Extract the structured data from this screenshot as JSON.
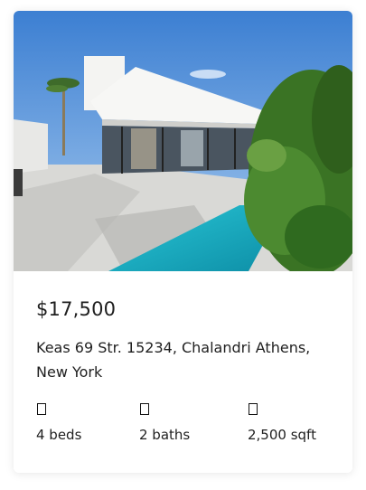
{
  "listing": {
    "price": "$17,500",
    "address": "Keas 69 Str. 15234, Chalandri Athens, New York",
    "features": [
      {
        "icon": "bed-icon",
        "label": "4 beds"
      },
      {
        "icon": "bath-icon",
        "label": "2 baths"
      },
      {
        "icon": "area-icon",
        "label": "2,500 sqft"
      }
    ]
  },
  "colors": {
    "sky": "#4f8fd8",
    "pool": "#1fb3c8",
    "foliage": "#3f7a2a",
    "text": "#1f1f1f"
  }
}
